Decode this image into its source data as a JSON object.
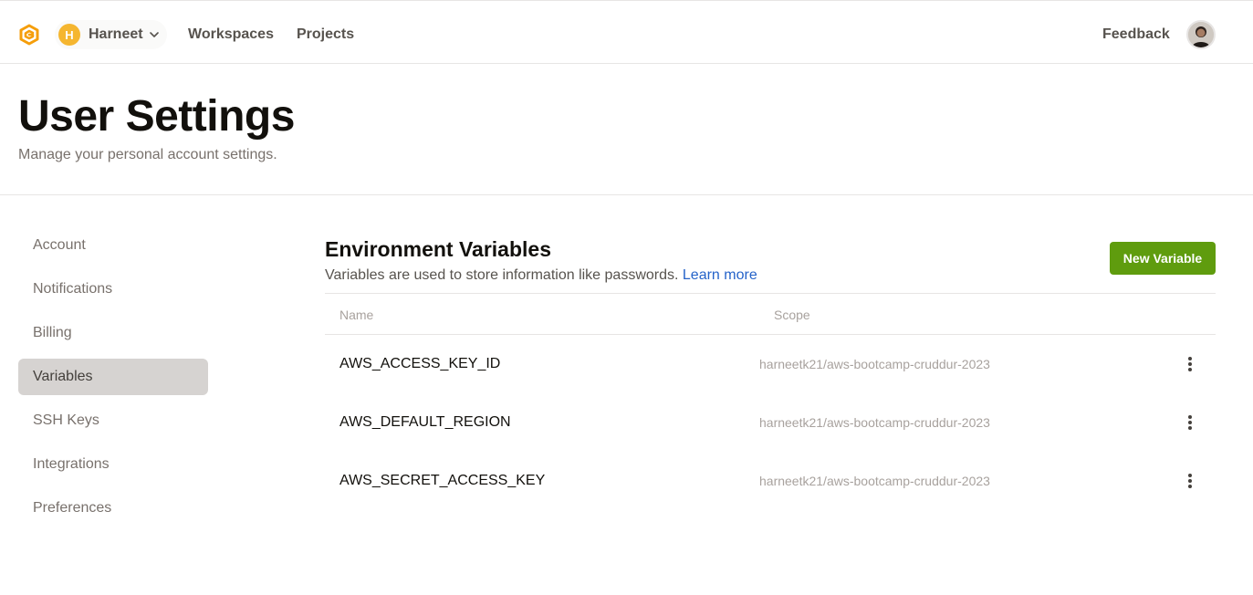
{
  "topbar": {
    "logo_icon": "gitpod-logo-icon",
    "org": {
      "initial": "H",
      "name": "Harneet",
      "chevron_icon": "chevron-down-icon"
    },
    "nav": [
      "Workspaces",
      "Projects"
    ],
    "feedback": "Feedback",
    "user_avatar_icon": "user-avatar-icon"
  },
  "header": {
    "title": "User Settings",
    "subtitle": "Manage your personal account settings."
  },
  "sidebar": {
    "items": [
      {
        "label": "Account",
        "active": false
      },
      {
        "label": "Notifications",
        "active": false
      },
      {
        "label": "Billing",
        "active": false
      },
      {
        "label": "Variables",
        "active": true
      },
      {
        "label": "SSH Keys",
        "active": false
      },
      {
        "label": "Integrations",
        "active": false
      },
      {
        "label": "Preferences",
        "active": false
      }
    ]
  },
  "main": {
    "title": "Environment Variables",
    "description": "Variables are used to store information like passwords.",
    "learn_more": "Learn more",
    "new_button": "New Variable",
    "table": {
      "columns": [
        "Name",
        "Scope"
      ],
      "rows": [
        {
          "name": "AWS_ACCESS_KEY_ID",
          "scope": "harneetk21/aws-bootcamp-cruddur-2023"
        },
        {
          "name": "AWS_DEFAULT_REGION",
          "scope": "harneetk21/aws-bootcamp-cruddur-2023"
        },
        {
          "name": "AWS_SECRET_ACCESS_KEY",
          "scope": "harneetk21/aws-bootcamp-cruddur-2023"
        }
      ],
      "row_menu_icon": "more-vertical-icon"
    }
  },
  "colors": {
    "accent_green": "#5f9c0e",
    "link_blue": "#2563c9",
    "brand_orange": "#f59e0b",
    "active_sidebar_bg": "#d6d3d1"
  }
}
